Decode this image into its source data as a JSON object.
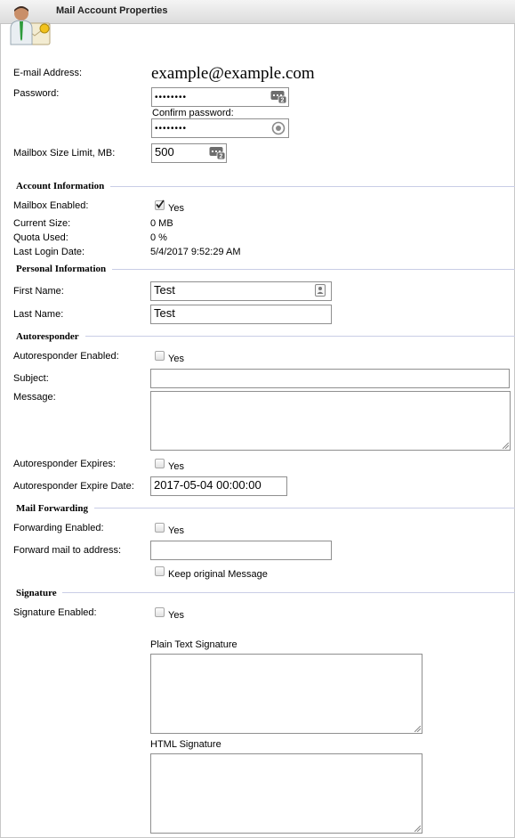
{
  "header": {
    "title": "Mail Account Properties"
  },
  "account": {
    "email_label": "E-mail Address:",
    "email_value": "example@example.com",
    "password_label": "Password:",
    "password_value": "••••••••",
    "confirm_label": "Confirm password:",
    "confirm_value": "••••••••",
    "mailbox_limit_label": "Mailbox Size Limit, MB:",
    "mailbox_limit_value": "500"
  },
  "account_info": {
    "heading": "Account Information",
    "mailbox_enabled_label": "Mailbox Enabled:",
    "mailbox_enabled_checked": true,
    "yes": "Yes",
    "current_size_label": "Current Size:",
    "current_size_value": "0 MB",
    "quota_used_label": "Quota Used:",
    "quota_used_value": "0 %",
    "last_login_label": "Last Login Date:",
    "last_login_value": "5/4/2017 9:52:29 AM"
  },
  "personal": {
    "heading": "Personal Information",
    "first_name_label": "First Name:",
    "first_name_value": "Test",
    "last_name_label": "Last Name:",
    "last_name_value": "Test"
  },
  "autoresponder": {
    "heading": "Autoresponder",
    "enabled_label": "Autoresponder Enabled:",
    "enabled_yes": "Yes",
    "subject_label": "Subject:",
    "subject_value": "",
    "message_label": "Message:",
    "message_value": "",
    "expires_label": "Autoresponder Expires:",
    "expires_yes": "Yes",
    "expire_date_label": "Autoresponder Expire Date:",
    "expire_date_value": "2017-05-04 00:00:00"
  },
  "forwarding": {
    "heading": "Mail Forwarding",
    "enabled_label": "Forwarding Enabled:",
    "enabled_yes": "Yes",
    "address_label": "Forward mail to address:",
    "address_value": "",
    "keep_original_label": "Keep original Message"
  },
  "signature": {
    "heading": "Signature",
    "enabled_label": "Signature Enabled:",
    "enabled_yes": "Yes",
    "plain_label": "Plain Text Signature",
    "html_label": "HTML Signature"
  }
}
